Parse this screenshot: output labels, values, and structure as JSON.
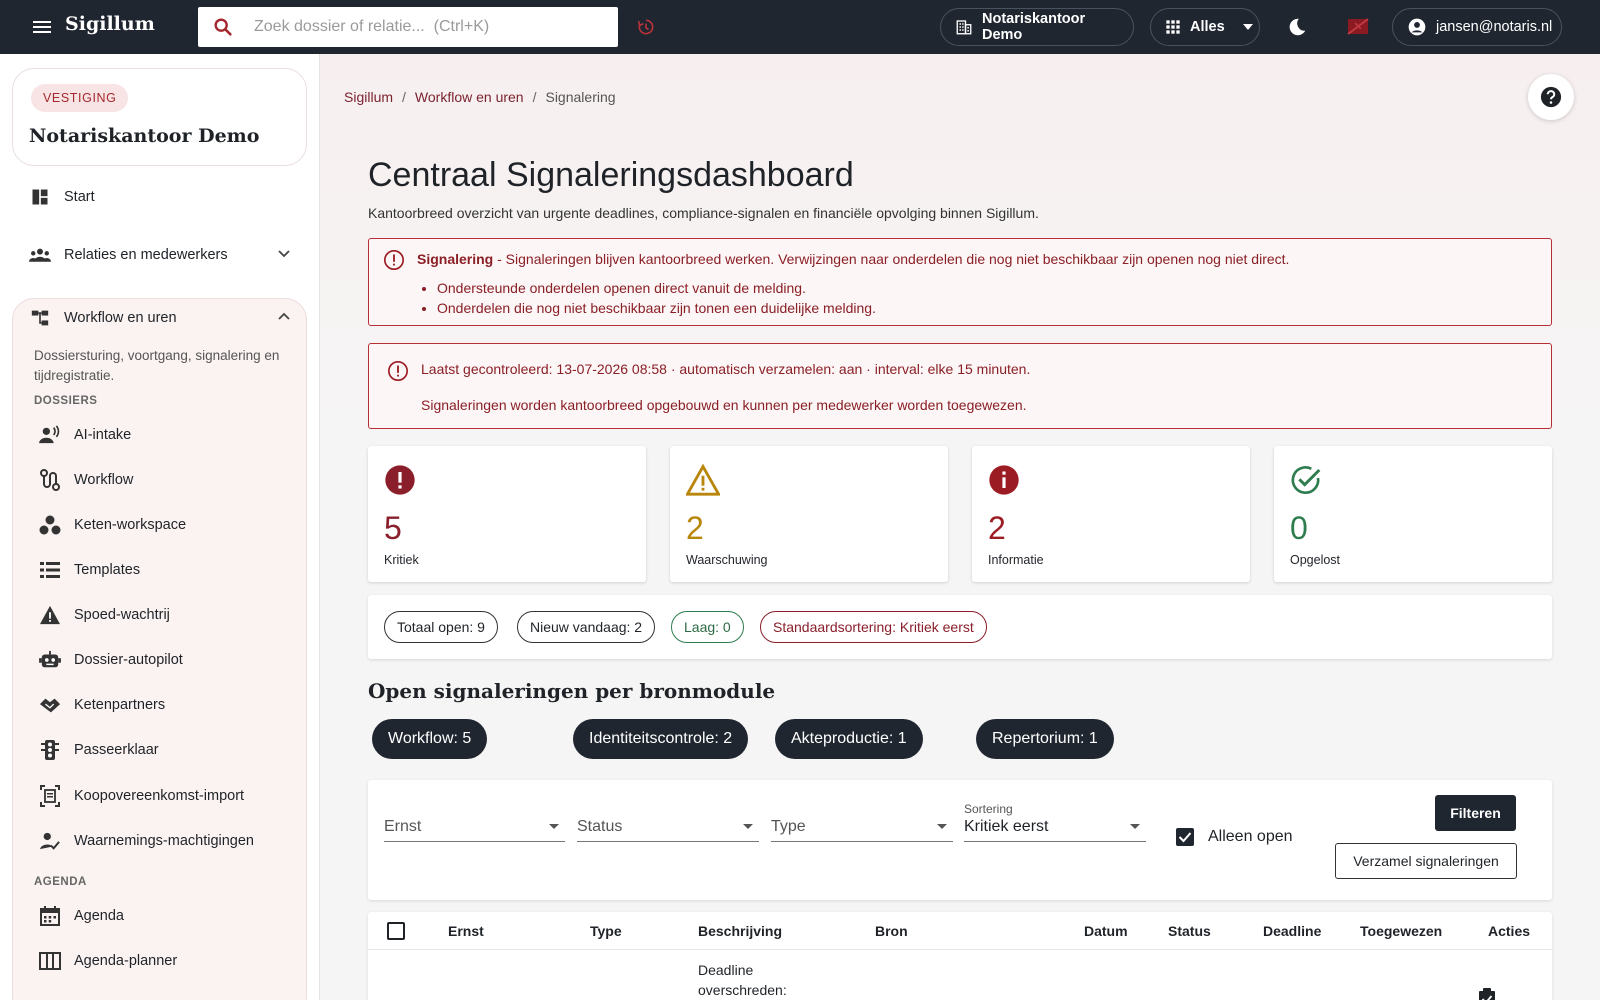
{
  "topbar": {
    "brand": "Sigillum",
    "search_placeholder": "Zoek dossier of relatie...  (Ctrl+K)",
    "office": "Notariskantoor Demo",
    "scope": "Alles",
    "user": "jansen@notaris.nl",
    "icons": [
      "menu-icon",
      "search-icon",
      "history-icon",
      "building-icon",
      "apps-icon",
      "chevron-down-icon",
      "moon-icon",
      "flag-icon",
      "account-icon"
    ]
  },
  "sidebar": {
    "vestiging_badge": "VESTIGING",
    "vestiging_name": "Notariskantoor Demo",
    "start": "Start",
    "relaties": "Relaties en medewerkers",
    "workflow_group": "Workflow en uren",
    "workflow_desc": "Dossiersturing, voortgang, signalering en tijdregistratie.",
    "section_dossiers": "DOSSIERS",
    "dossier_items": [
      {
        "label": "AI-intake",
        "icon": "voice-person-icon"
      },
      {
        "label": "Workflow",
        "icon": "route-icon"
      },
      {
        "label": "Keten-workspace",
        "icon": "workspaces-icon"
      },
      {
        "label": "Templates",
        "icon": "list-icon"
      },
      {
        "label": "Spoed-wachtrij",
        "icon": "warning-icon"
      },
      {
        "label": "Dossier-autopilot",
        "icon": "robot-icon"
      },
      {
        "label": "Ketenpartners",
        "icon": "handshake-icon"
      },
      {
        "label": "Passeerklaar",
        "icon": "traffic-icon"
      },
      {
        "label": "Koopovereenkomst-import",
        "icon": "document-scan-icon"
      },
      {
        "label": "Waarnemings-machtigingen",
        "icon": "person-check-icon"
      }
    ],
    "section_agenda": "AGENDA",
    "agenda_items": [
      {
        "label": "Agenda",
        "icon": "calendar-icon"
      },
      {
        "label": "Agenda-planner",
        "icon": "calendar-view-icon"
      }
    ]
  },
  "breadcrumb": {
    "root": "Sigillum",
    "section": "Workflow en uren",
    "current": "Signalering"
  },
  "page": {
    "title": "Centraal Signaleringsdashboard",
    "subtitle": "Kantoorbreed overzicht van urgente deadlines, compliance-signalen en financiële opvolging binnen Sigillum."
  },
  "alert1": {
    "title": "Signalering",
    "text": " - Signaleringen blijven kantoorbreed werken. Verwijzingen naar onderdelen die nog niet beschikbaar zijn openen nog niet direct.",
    "bullet1": "Ondersteunde onderdelen openen direct vanuit de melding.",
    "bullet2": "Onderdelen die nog niet beschikbaar zijn tonen een duidelijke melding."
  },
  "alert2": {
    "line1": "Laatst gecontroleerd: 13-07-2026 08:58 · automatisch verzamelen: aan · interval: elke 15 minuten.",
    "line2": "Signaleringen worden kantoorbreed opgebouwd en kunnen per medewerker worden toegewezen."
  },
  "stats": [
    {
      "value": "5",
      "label": "Kritiek",
      "color": "#8a1f2b",
      "icon": "error-icon"
    },
    {
      "value": "2",
      "label": "Waarschuwing",
      "color": "#b8860b",
      "icon": "warning-icon"
    },
    {
      "value": "2",
      "label": "Informatie",
      "color": "#9b1c22",
      "icon": "info-icon"
    },
    {
      "value": "0",
      "label": "Opgelost",
      "color": "#2e7d4f",
      "icon": "check-circle-icon"
    }
  ],
  "chips": {
    "total": "Totaal open: 9",
    "today": "Nieuw vandaag: 2",
    "low": "Laag: 0",
    "sort": "Standaardsortering: Kritiek eerst"
  },
  "modules": {
    "title": "Open signaleringen per bronmodule",
    "items": [
      "Workflow: 5",
      "Identiteitscontrole: 2",
      "Akteproductie: 1",
      "Repertorium: 1"
    ]
  },
  "filters": {
    "ernst": "Ernst",
    "status": "Status",
    "type": "Type",
    "sort_label": "Sortering",
    "sort_value": "Kritiek eerst",
    "only_open": "Alleen open",
    "filter_btn": "Filteren",
    "collect_btn": "Verzamel signaleringen"
  },
  "table": {
    "headers": [
      "Ernst",
      "Type",
      "Beschrijving",
      "Bron",
      "Datum",
      "Status",
      "Deadline",
      "Toegewezen",
      "Acties"
    ],
    "row1_desc": "Deadline overschreden:"
  }
}
